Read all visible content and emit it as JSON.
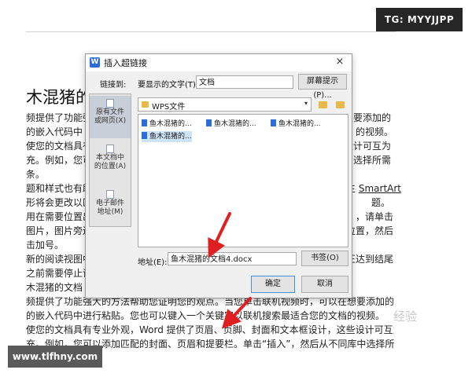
{
  "badges": {
    "tg": "TG: MYYJJPP",
    "url": "www.tlfhny.com",
    "watermark": "经验"
  },
  "document": {
    "title_fragment": "木混猪的",
    "lines": [
      "频提供了功能强",
      "的嵌入代码中",
      "使您的文档具有",
      "充。例如，您可",
      "条。",
      "题和样式也有助",
      "形将会更改以匹",
      "用在需要位置出",
      "图片，图片旁边",
      "击加号。",
      "新的阅读视图中",
      "之前需要停止读",
      "木混猪的文档",
      "频提供了功能强大的方法帮助您证明您的观点。当您单击联机视频时，可以在想要添加的",
      "的嵌入代码中进行粘贴。您也可以键入一个关键字以联机搜索最适合您的文档的视频。",
      "使您的文档具有专业外观，Word 提供了页眉、页脚、封面和文本框设计，这些设计可互为",
      "充。例如，您可以添加匹配的封面、页眉和提要栏。单击“插入”，然后从不同库中选择所需"
    ],
    "right_fragments": [
      "想要添加的",
      "的视频。",
      "设计可互为",
      "中选择所需",
      "SmartArt",
      "题。",
      "，请单击",
      "位置，然后",
      "正达到结尾"
    ],
    "smartart_prefix": "主"
  },
  "dialog": {
    "title": "插入超链接",
    "close": "×",
    "link_to_label": "链接到:",
    "display_text_label": "要显示的文字(T):",
    "display_text_value": "文档",
    "screen_tip_button": "屏幕提示(P)...",
    "nav": [
      {
        "label": "原有文件\n或网页(X)",
        "active": true
      },
      {
        "label": "本文档中\n的位置(A)",
        "active": false
      },
      {
        "label": "电子邮件\n地址(M)",
        "active": false
      }
    ],
    "folder": "WPS文件",
    "files": [
      {
        "name": "鱼木混猪的...",
        "selected": false
      },
      {
        "name": "鱼木混猪的...",
        "selected": false
      },
      {
        "name": "鱼木混猪的...",
        "selected": false
      },
      {
        "name": "鱼木混猪的...",
        "selected": true
      }
    ],
    "address_label": "地址(E):",
    "address_value": "鱼木混猪的文档4.docx",
    "bookmark_button": "书签(O)",
    "ok_button": "确定",
    "cancel_button": "取消"
  },
  "colors": {
    "accent": "#2b6fd6",
    "arrow": "#e02020",
    "folder": "#e8b84a"
  }
}
